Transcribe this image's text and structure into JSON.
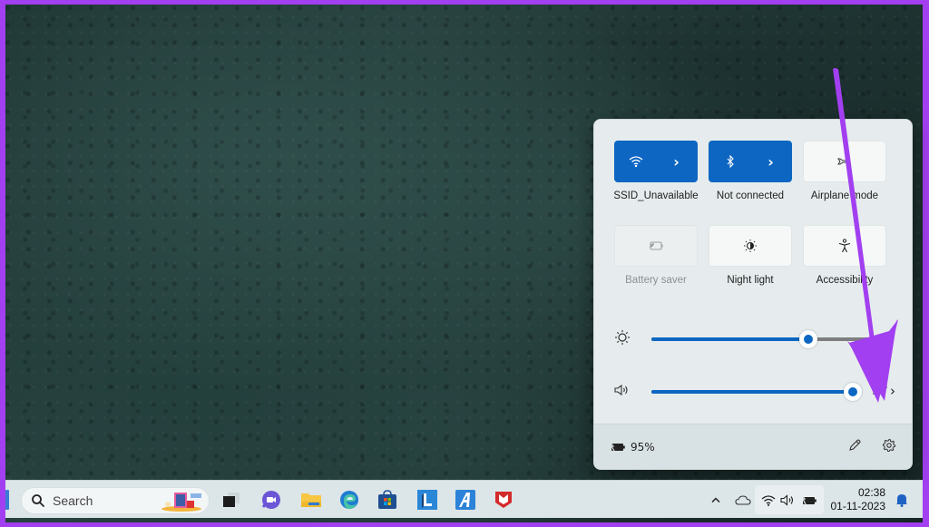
{
  "quick_settings": {
    "tiles": [
      {
        "label": "SSID_Unavailable",
        "icon": "wifi-icon",
        "state": "on",
        "has_chevron": true
      },
      {
        "label": "Not connected",
        "icon": "bluetooth-icon",
        "state": "on",
        "has_chevron": true
      },
      {
        "label": "Airplane mode",
        "icon": "airplane-icon",
        "state": "off",
        "has_chevron": false
      },
      {
        "label": "Battery saver",
        "icon": "battery-saver-icon",
        "state": "disabled",
        "has_chevron": false
      },
      {
        "label": "Night light",
        "icon": "night-light-icon",
        "state": "off",
        "has_chevron": false
      },
      {
        "label": "Accessibility",
        "icon": "accessibility-icon",
        "state": "off",
        "has_chevron": false
      }
    ],
    "brightness": {
      "icon": "brightness-icon",
      "value_percent": 72
    },
    "volume": {
      "icon": "speaker-icon",
      "value_percent": 100,
      "output_button_icon": "audio-output-icon"
    },
    "footer": {
      "battery_icon": "battery-charging-icon",
      "battery_percent": "95%",
      "edit_icon": "pencil-icon",
      "settings_icon": "gear-icon"
    },
    "accent_color": "#0c66c2"
  },
  "taskbar": {
    "search_placeholder": "Search",
    "pinned_apps": [
      {
        "name": "task-view"
      },
      {
        "name": "teams-chat"
      },
      {
        "name": "file-explorer"
      },
      {
        "name": "edge"
      },
      {
        "name": "microsoft-store"
      },
      {
        "name": "app-l"
      },
      {
        "name": "app-a"
      },
      {
        "name": "mcafee"
      }
    ],
    "tray": {
      "show_hidden_icon": "chevron-up-icon",
      "onedrive_icon": "cloud-icon",
      "wifi_icon": "wifi-icon",
      "volume_icon": "speaker-icon",
      "battery_icon": "battery-charging-icon"
    },
    "clock": {
      "time": "02:38",
      "date": "01-11-2023"
    },
    "notification_icon": "bell-icon"
  },
  "annotation": {
    "color": "#a23ff0",
    "points_to": "audio-output-button"
  }
}
